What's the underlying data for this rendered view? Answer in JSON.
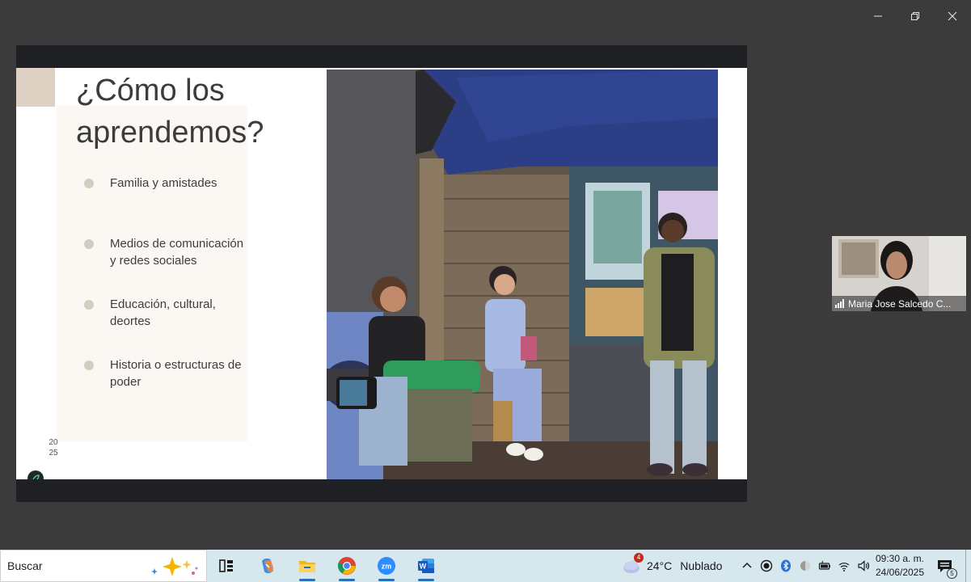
{
  "window": {
    "controls": [
      "minimize",
      "restore",
      "close"
    ]
  },
  "slide": {
    "title": "¿Cómo los\naprendemos?",
    "bullets": [
      "Familia y amistades",
      "Medios de comunicación\ny redes sociales",
      "Educación, cultural,\ndeortes",
      "Historia o estructuras de\npoder"
    ],
    "year": "20\n25",
    "colors": {
      "accent": "#ddd1c3",
      "panel": "#fbf8f4",
      "bullet": "#d5ccc0",
      "text": "#3c3c3c"
    }
  },
  "participant": {
    "name": "Maria Jose Salcedo C..."
  },
  "taskbar": {
    "search_placeholder": "Buscar",
    "apps": [
      "task-view-icon",
      "copilot-icon",
      "file-explorer-icon",
      "chrome-icon",
      "zoom-icon",
      "word-icon"
    ],
    "weather": {
      "badge": "4",
      "temp": "24°C",
      "condition": "Nublado"
    },
    "clock": {
      "time": "09:30 a. m.",
      "date": "24/06/2025"
    },
    "notifications": {
      "count": "5"
    }
  }
}
